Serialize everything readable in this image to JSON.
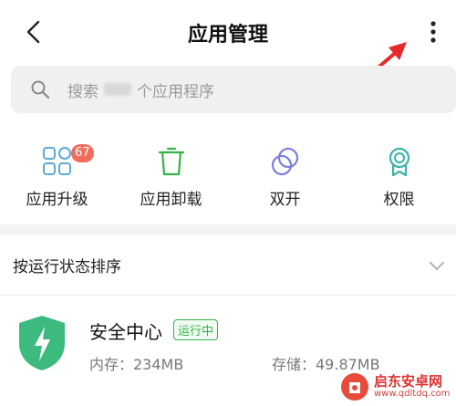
{
  "header": {
    "title": "应用管理"
  },
  "search": {
    "placeholder_prefix": "搜索",
    "placeholder_suffix": "个应用程序"
  },
  "shortcuts": [
    {
      "label": "应用升级",
      "icon": "upgrade-grid-icon",
      "badge": "67"
    },
    {
      "label": "应用卸载",
      "icon": "trash-icon"
    },
    {
      "label": "双开",
      "icon": "dual-circles-icon"
    },
    {
      "label": "权限",
      "icon": "permission-ribbon-icon"
    }
  ],
  "sort": {
    "label": "按运行状态排序"
  },
  "apps": [
    {
      "name": "安全中心",
      "status": "运行中",
      "memory": "内存：234MB",
      "storage": "存储：49.87MB"
    }
  ],
  "watermark": {
    "brand": "启东安卓网",
    "url": "www.qdltdq.com"
  },
  "colors": {
    "accent_green": "#37b34a",
    "badge_red": "#f26b5b",
    "icon_teal": "#5aa9d6",
    "arrow_red": "#e52b2b"
  }
}
